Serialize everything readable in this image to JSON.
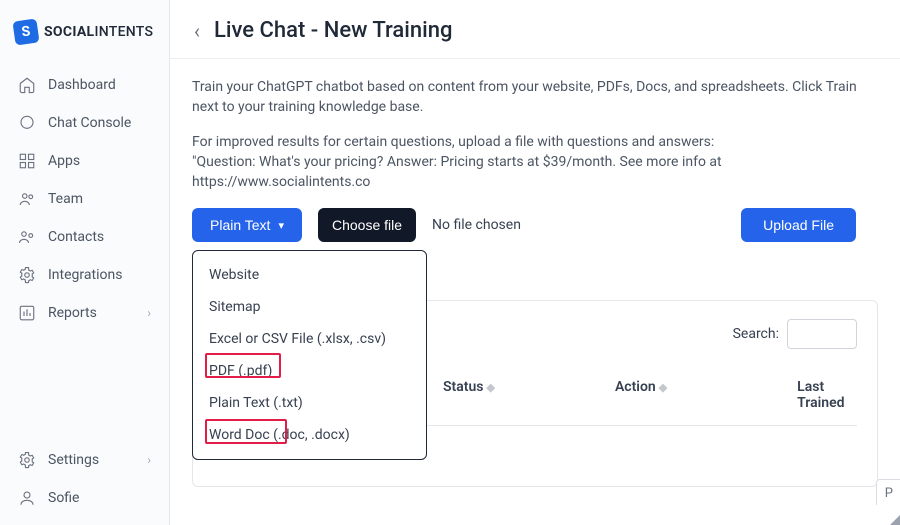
{
  "brand": {
    "name_part1": "SOCIAL",
    "name_part2": "INTENTS"
  },
  "sidebar": {
    "items": [
      {
        "label": "Dashboard"
      },
      {
        "label": "Chat Console"
      },
      {
        "label": "Apps"
      },
      {
        "label": "Team"
      },
      {
        "label": "Contacts"
      },
      {
        "label": "Integrations"
      },
      {
        "label": "Reports"
      }
    ],
    "bottom": [
      {
        "label": "Settings"
      },
      {
        "label": "Sofie"
      }
    ]
  },
  "page": {
    "title": "Live Chat - New Training",
    "intro1": "Train your ChatGPT chatbot based on content from your website, PDFs, Docs, and spreadsheets. Click Train next to your training knowledge base.",
    "intro2a": "For improved results for certain questions, upload a file with questions and answers:",
    "intro2b": "\"Question: What's your pricing? Answer: Pricing starts at $39/month. See more info at https://www.socialintents.co"
  },
  "controls": {
    "type_button": "Plain Text",
    "choose_file": "Choose file",
    "file_status": "No file chosen",
    "upload": "Upload File"
  },
  "dropdown": {
    "items": [
      "Website",
      "Sitemap",
      "Excel or CSV File (.xlsx, .csv)",
      "PDF (.pdf)",
      "Plain Text (.txt)",
      "Word Doc (.doc, .docx)"
    ]
  },
  "table": {
    "search_label": "Search:",
    "headers": {
      "status": "Status",
      "action": "Action",
      "last_trained": "Last Trained"
    },
    "prev": "P"
  }
}
